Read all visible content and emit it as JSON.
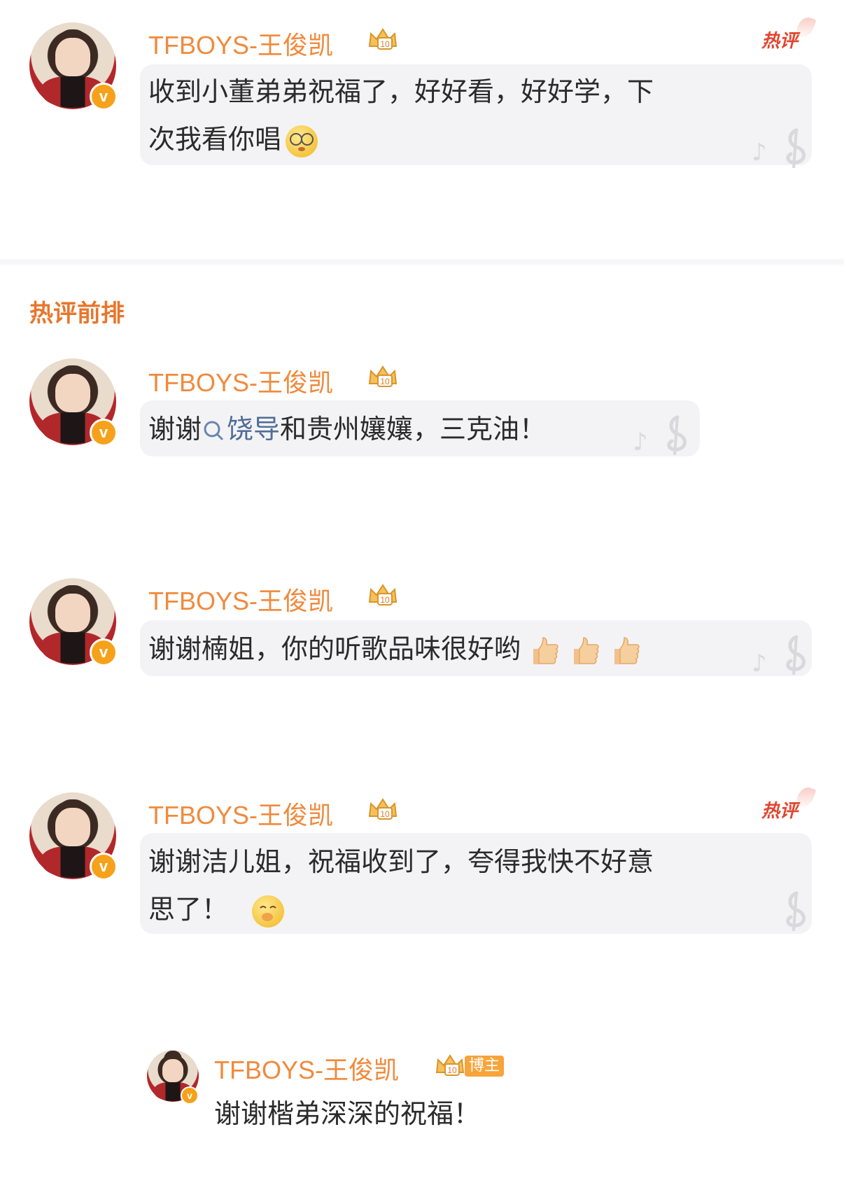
{
  "section_title": "热评前排",
  "hot_label": "热评",
  "blogger_label": "博主",
  "comments": [
    {
      "username": "TFBOYS-王俊凯",
      "verified_icon": "v-badge-icon",
      "text_line1": "收到小董弟弟祝福了，好好看，好好学，下",
      "text_line2": "次我看你唱",
      "emoji": "glasses-emoji-icon"
    },
    {
      "username": "TFBOYS-王俊凯",
      "text_prefix": "谢谢",
      "link_text": "饶导",
      "text_suffix": "和贵州孃孃，三克油！"
    },
    {
      "username": "TFBOYS-王俊凯",
      "text": "谢谢楠姐，你的听歌品味很好哟",
      "emoji": "thumbs-up-icon"
    },
    {
      "username": "TFBOYS-王俊凯",
      "text_line1": "谢谢洁儿姐，祝福收到了，夸得我快不好意",
      "text_line2": "思了！",
      "emoji": "shy-face-emoji-icon"
    },
    {
      "username": "TFBOYS-王俊凯",
      "text": "谢谢楷弟深深的祝福！"
    }
  ],
  "colors": {
    "username": "#f08a3c",
    "hot": "#e2452e",
    "link": "#4f6d97",
    "verified": "#f5a21a",
    "bubble": "#f3f3f6"
  }
}
